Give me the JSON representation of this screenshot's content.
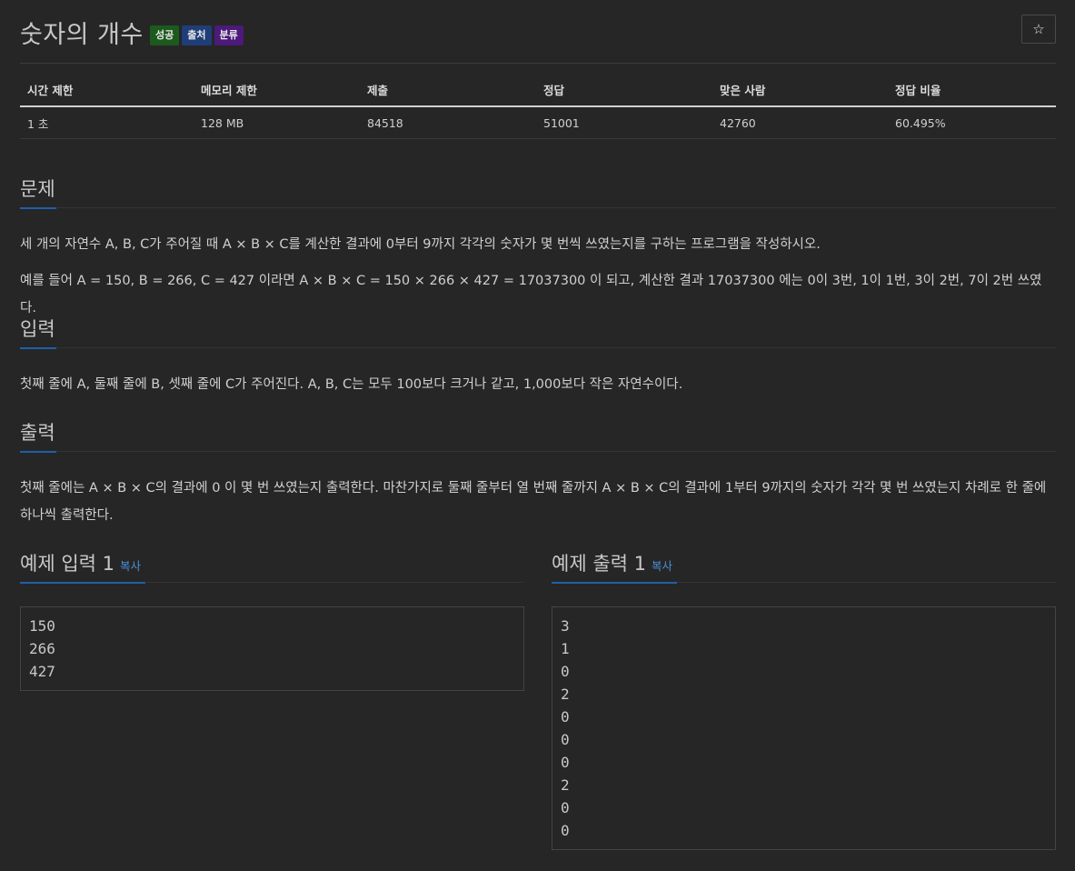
{
  "problem": {
    "title": "숫자의 개수",
    "badges": {
      "success": "성공",
      "source": "출처",
      "category": "분류"
    }
  },
  "info_table": {
    "headers": [
      "시간 제한",
      "메모리 제한",
      "제출",
      "정답",
      "맞은 사람",
      "정답 비율"
    ],
    "values": [
      "1 초",
      "128 MB",
      "84518",
      "51001",
      "42760",
      "60.495%"
    ]
  },
  "sections": {
    "problem": {
      "heading": "문제",
      "paragraphs": [
        "세 개의 자연수 A, B, C가 주어질 때 A × B × C를 계산한 결과에 0부터 9까지 각각의 숫자가 몇 번씩 쓰였는지를 구하는 프로그램을 작성하시오.",
        "예를 들어 A = 150, B = 266, C = 427 이라면 A × B × C = 150 × 266 × 427 = 17037300 이 되고, 계산한 결과 17037300 에는 0이 3번, 1이 1번, 3이 2번, 7이 2번 쓰였다."
      ]
    },
    "input": {
      "heading": "입력",
      "paragraphs": [
        "첫째 줄에 A, 둘째 줄에 B, 셋째 줄에 C가 주어진다. A, B, C는 모두 100보다 크거나 같고, 1,000보다 작은 자연수이다."
      ]
    },
    "output": {
      "heading": "출력",
      "paragraphs": [
        "첫째 줄에는 A × B × C의 결과에 0 이 몇 번 쓰였는지 출력한다. 마찬가지로 둘째 줄부터 열 번째 줄까지 A × B × C의 결과에 1부터 9까지의 숫자가 각각 몇 번 쓰였는지 차례로 한 줄에 하나씩 출력한다."
      ]
    }
  },
  "samples": {
    "input": {
      "heading": "예제 입력 1",
      "copy_label": "복사",
      "lines": [
        "150",
        "266",
        "427"
      ]
    },
    "output": {
      "heading": "예제 출력 1",
      "copy_label": "복사",
      "lines": [
        "3",
        "1",
        "0",
        "2",
        "0",
        "0",
        "0",
        "2",
        "0",
        "0"
      ]
    }
  },
  "icons": {
    "star": "star-icon"
  },
  "colors": {
    "background": "#262626",
    "accent": "#1f5fa8",
    "copy_link": "#4a8fd8",
    "badge_success": "#1d5a1d",
    "badge_source": "#1f3d78",
    "badge_category": "#4b1a7a"
  }
}
